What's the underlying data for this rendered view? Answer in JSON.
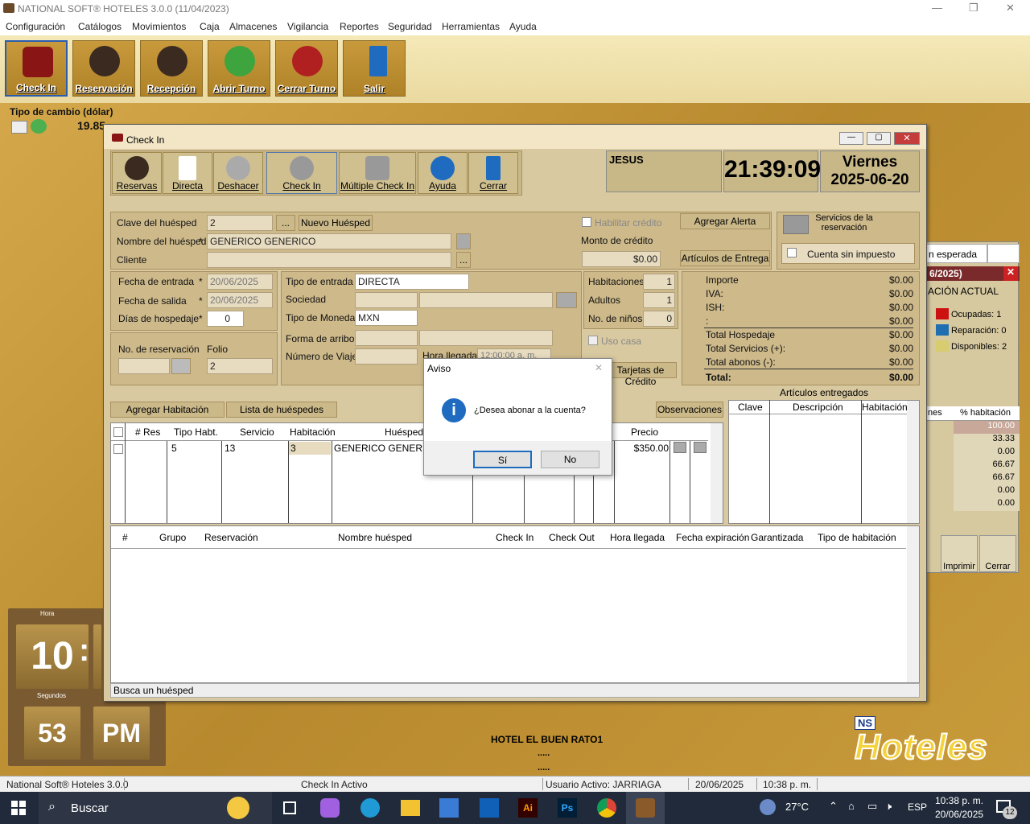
{
  "app": {
    "title": "NATIONAL SOFT® HOTELES 3.0.0 (11/04/2023)"
  },
  "menu": [
    "Configuración",
    "Catálogos",
    "Movimientos",
    "Caja",
    "Almacenes",
    "Vigilancia",
    "Reportes",
    "Seguridad",
    "Herramientas",
    "Ayuda"
  ],
  "toolbar": [
    "Check In",
    "Reservación",
    "Recepción",
    "Abrir Turno",
    "Cerrar Turno",
    "Salir"
  ],
  "exchange": {
    "label": "Tipo de cambio (dólar)",
    "value": "19.85"
  },
  "checkin": {
    "title": "Check In",
    "tools": [
      "Reservas",
      "Directa",
      "Deshacer",
      "Check In",
      "Múltiple Check In",
      "Ayuda",
      "Cerrar"
    ],
    "user": "JESUS",
    "time": "21:39:09",
    "day": "Viernes",
    "date": "2025-06-20",
    "guest": {
      "key_label": "Clave del huésped",
      "key_value": "2",
      "new_guest": "Nuevo Huésped",
      "name_label": "Nombre del huésped",
      "name_value": "GENERICO  GENERICO",
      "client_label": "Cliente",
      "credit_label": "Habilitar crédito",
      "credit_amount_label": "Monto de crédito",
      "credit_amount": "$0.00",
      "add_alert": "Agregar Alerta",
      "delivery_items": "Artículos de Entrega",
      "services": "Servicios de la reservación",
      "no_tax": "Cuenta sin impuesto"
    },
    "dates": {
      "in_label": "Fecha de entrada",
      "in_value": "20/06/2025",
      "out_label": "Fecha de salida",
      "out_value": "20/06/2025",
      "days_label": "Días de hospedaje",
      "days_value": "0",
      "res_label": "No. de reservación",
      "folio_label": "Folio",
      "folio_value": "2"
    },
    "entry": {
      "type_label": "Tipo de entrada",
      "type_value": "DIRECTA",
      "company_label": "Sociedad",
      "currency_label": "Tipo de Moneda",
      "currency_value": "MXN",
      "arrival_form_label": "Forma de arribo",
      "trip_label": "Número de Viaje",
      "arrival_time_label": "Hora llegada",
      "arrival_time_value": "12:00:00 a. m."
    },
    "counts": {
      "rooms_label": "Habitaciones",
      "rooms": "1",
      "adults_label": "Adultos",
      "adults": "1",
      "kids_label": "No. de niños",
      "kids": "0",
      "house_use": "Uso casa",
      "cards": "Tarjetas de Crédito"
    },
    "totals": [
      {
        "label": "Importe",
        "value": "$0.00"
      },
      {
        "label": "IVA:",
        "value": "$0.00"
      },
      {
        "label": "ISH:",
        "value": "$0.00"
      },
      {
        "label": ":",
        "value": "$0.00"
      },
      {
        "label": "Total Hospedaje",
        "value": "$0.00"
      },
      {
        "label": "Total Servicios (+):",
        "value": "$0.00"
      },
      {
        "label": "Total abonos (-):",
        "value": "$0.00"
      },
      {
        "label": "Total:",
        "value": "$0.00"
      }
    ],
    "room_buttons": {
      "add": "Agregar Habitación",
      "list": "Lista de huéspedes",
      "notes": "Observaciones"
    },
    "room_headers": [
      "# Res",
      "Tipo Habt.",
      "Servicio",
      "Habitación",
      "Huésped",
      "Precio"
    ],
    "room_row": {
      "tipo": "5",
      "servicio": "13",
      "habitacion": "3",
      "huesped": "GENERICO  GENERICO",
      "precio": "$350.00"
    },
    "items": {
      "title": "Artículos entregados",
      "headers": [
        "Clave",
        "Descripción",
        "Habitación"
      ]
    },
    "list_headers": [
      "#",
      "Grupo",
      "Reservación",
      "Nombre huésped",
      "Check In",
      "Check Out",
      "Hora llegada",
      "Fecha expiración",
      "Garantizada",
      "Tipo de habitación"
    ],
    "search_hint": "Busca un huésped"
  },
  "dialog": {
    "title": "Aviso",
    "message": "¿Desea abonar a la cuenta?",
    "yes": "Sí",
    "no": "No"
  },
  "rightpane": {
    "tab": "n esperada",
    "date": "6/2025)",
    "heading": "ACIÓN ACTUAL",
    "legend": [
      {
        "label": "Ocupadas: 1",
        "color": "#cc1111"
      },
      {
        "label": "Reparación: 0",
        "color": "#1f6fb0"
      },
      {
        "label": "Disponibles: 2",
        "color": "#d8cc70"
      }
    ],
    "col1": "nes",
    "col2": "% habitación",
    "pct": [
      "100.00",
      "33.33",
      "0.00",
      "66.67",
      "66.67",
      "0.00",
      "0.00"
    ],
    "print": "Imprimir",
    "close": "Cerrar"
  },
  "clock": {
    "hora_label": "Hora",
    "hour": "10",
    "sep": ":",
    "seg_label": "Segundos",
    "seconds": "53",
    "ampm": "PM"
  },
  "hotel": {
    "name": "HOTEL EL BUEN RATO1",
    "dots1": ".....",
    "dots2": ".....",
    "logo_ns": "NS",
    "logo": "Hoteles"
  },
  "status": {
    "app": "National Soft® Hoteles 3.0.0",
    "mode": "Check In Activo",
    "user": "Usuario Activo: JARRIAGA",
    "date": "20/06/2025",
    "time": "10:38 p. m."
  },
  "taskbar": {
    "search": "Buscar",
    "weather": "27°C",
    "lang": "ESP",
    "time": "10:38 p. m.",
    "date": "20/06/2025",
    "notif": "12"
  }
}
